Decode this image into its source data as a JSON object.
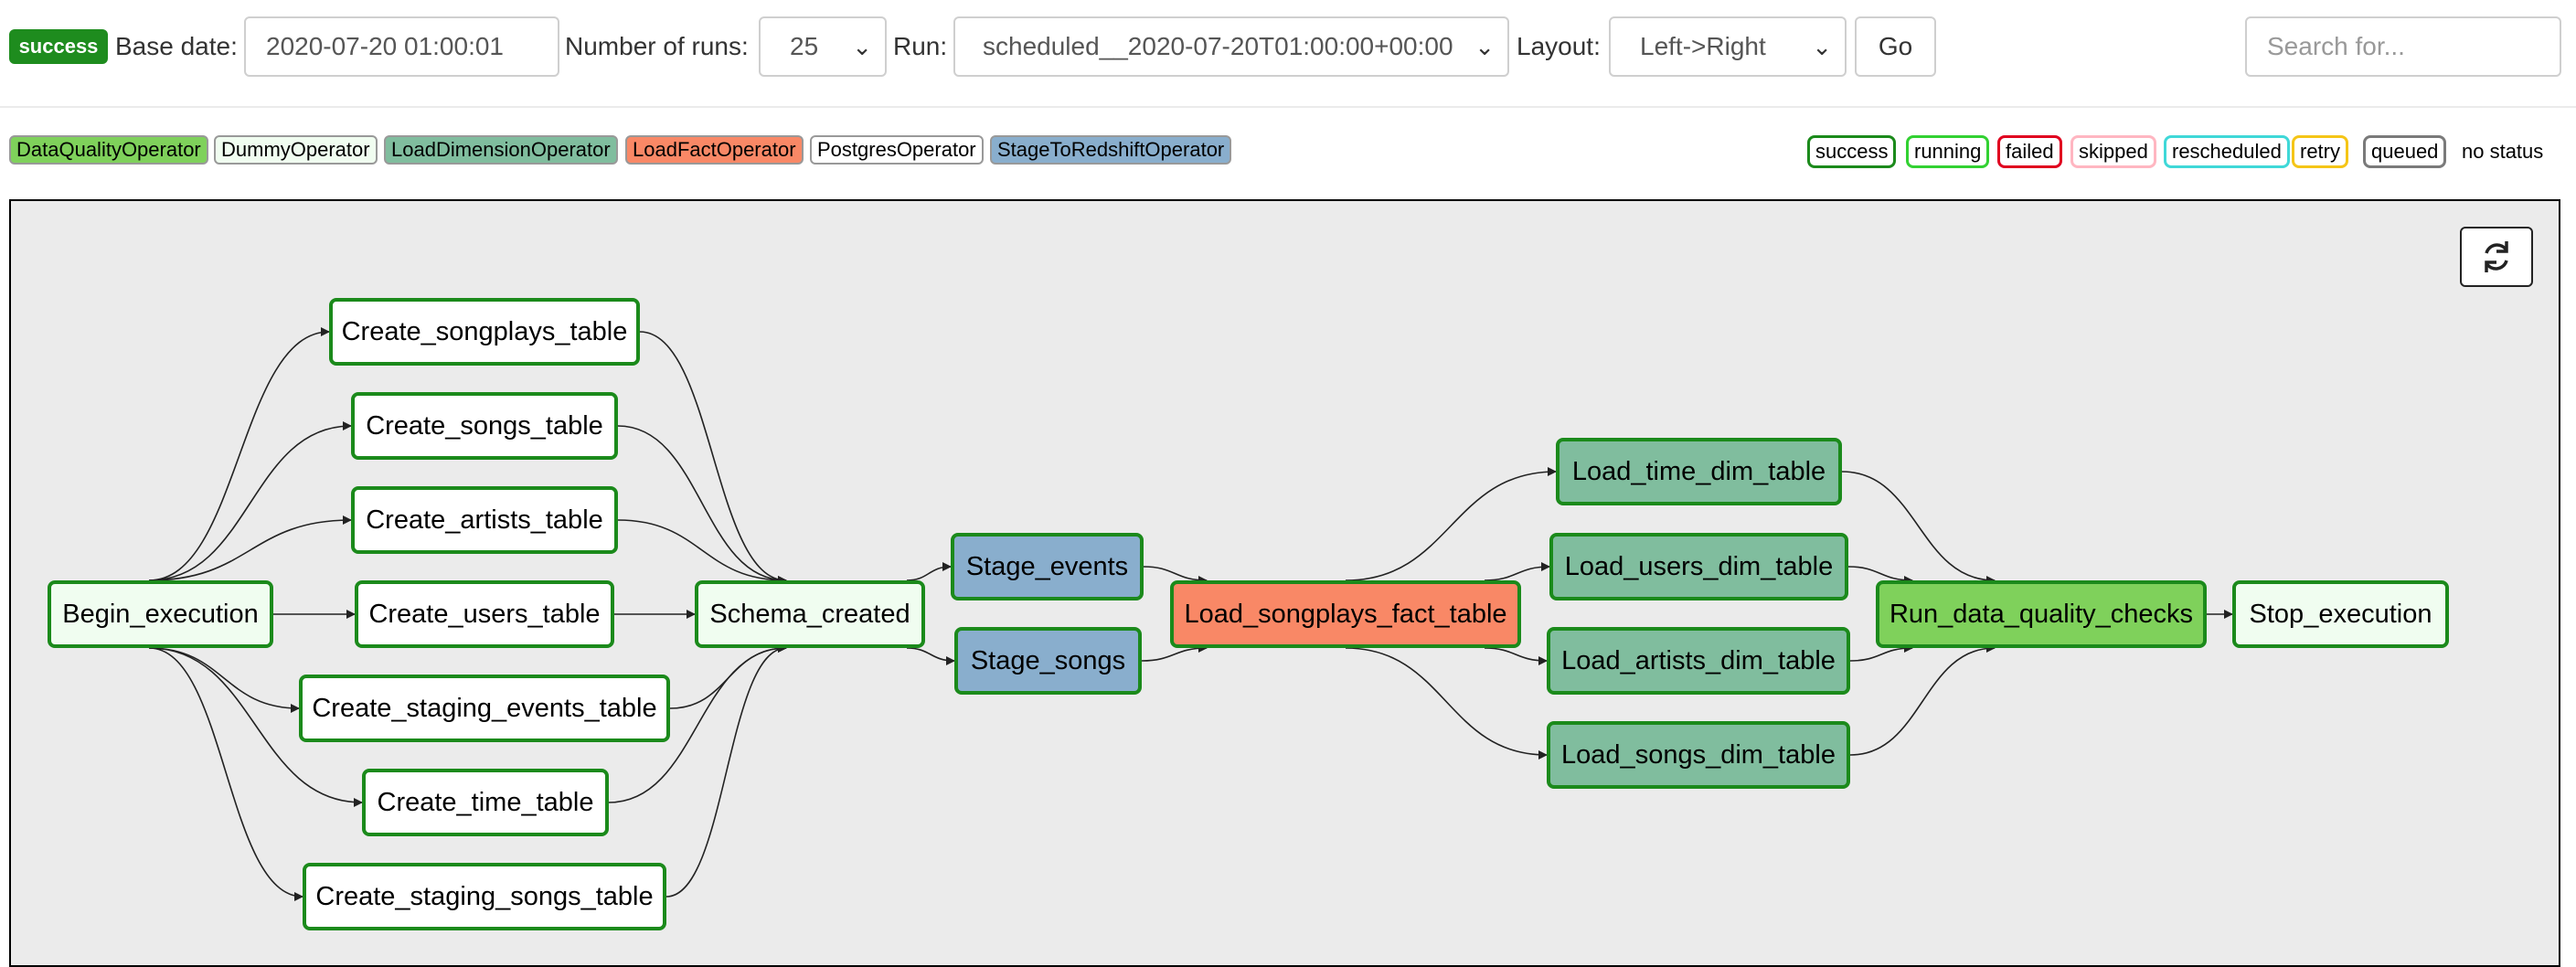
{
  "header": {
    "state_badge": "success",
    "base_date_label": "Base date:",
    "base_date_value": "2020-07-20 01:00:01",
    "num_runs_label": "Number of runs:",
    "num_runs_value": "25",
    "run_label": "Run:",
    "run_value": "scheduled__2020-07-20T01:00:00+00:00",
    "layout_label": "Layout:",
    "layout_value": "Left->Right",
    "go_label": "Go",
    "search_placeholder": "Search for..."
  },
  "operators": [
    {
      "label": "DataQualityOperator",
      "color": "#7fd15b"
    },
    {
      "label": "DummyOperator",
      "color": "#f0fdf0"
    },
    {
      "label": "LoadDimensionOperator",
      "color": "#80bd9e"
    },
    {
      "label": "LoadFactOperator",
      "color": "#f98866"
    },
    {
      "label": "PostgresOperator",
      "color": "#ffffff"
    },
    {
      "label": "StageToRedshiftOperator",
      "color": "#89aecd"
    }
  ],
  "states": [
    {
      "label": "success",
      "color": "#1b8a1b"
    },
    {
      "label": "running",
      "color": "#32d132"
    },
    {
      "label": "failed",
      "color": "#e0001f"
    },
    {
      "label": "skipped",
      "color": "#ffb6c1"
    },
    {
      "label": "rescheduled",
      "color": "#3fd8d8"
    },
    {
      "label": "retry",
      "color": "#f5c517"
    },
    {
      "label": "queued",
      "color": "#7a7a7a"
    },
    {
      "label": "no status",
      "color": ""
    }
  ],
  "refresh_icon": "refresh-icon",
  "tasks": [
    {
      "id": "begin",
      "label": "Begin_execution",
      "color": "#f0fdf0"
    },
    {
      "id": "c_songplays",
      "label": "Create_songplays_table",
      "color": "#ffffff"
    },
    {
      "id": "c_songs",
      "label": "Create_songs_table",
      "color": "#ffffff"
    },
    {
      "id": "c_artists",
      "label": "Create_artists_table",
      "color": "#ffffff"
    },
    {
      "id": "c_users",
      "label": "Create_users_table",
      "color": "#ffffff"
    },
    {
      "id": "c_staging_events",
      "label": "Create_staging_events_table",
      "color": "#ffffff"
    },
    {
      "id": "c_time",
      "label": "Create_time_table",
      "color": "#ffffff"
    },
    {
      "id": "c_staging_songs",
      "label": "Create_staging_songs_table",
      "color": "#ffffff"
    },
    {
      "id": "schema",
      "label": "Schema_created",
      "color": "#f0fdf0"
    },
    {
      "id": "stage_events",
      "label": "Stage_events",
      "color": "#89aecd"
    },
    {
      "id": "stage_songs",
      "label": "Stage_songs",
      "color": "#89aecd"
    },
    {
      "id": "load_fact",
      "label": "Load_songplays_fact_table",
      "color": "#f98866"
    },
    {
      "id": "load_time",
      "label": "Load_time_dim_table",
      "color": "#80bd9e"
    },
    {
      "id": "load_users",
      "label": "Load_users_dim_table",
      "color": "#80bd9e"
    },
    {
      "id": "load_artists",
      "label": "Load_artists_dim_table",
      "color": "#80bd9e"
    },
    {
      "id": "load_songs",
      "label": "Load_songs_dim_table",
      "color": "#80bd9e"
    },
    {
      "id": "dq",
      "label": "Run_data_quality_checks",
      "color": "#7fd15b"
    },
    {
      "id": "stop",
      "label": "Stop_execution",
      "color": "#f0fdf0"
    }
  ],
  "edges": [
    [
      "begin",
      "c_songplays"
    ],
    [
      "begin",
      "c_songs"
    ],
    [
      "begin",
      "c_artists"
    ],
    [
      "begin",
      "c_users"
    ],
    [
      "begin",
      "c_staging_events"
    ],
    [
      "begin",
      "c_time"
    ],
    [
      "begin",
      "c_staging_songs"
    ],
    [
      "c_songplays",
      "schema"
    ],
    [
      "c_songs",
      "schema"
    ],
    [
      "c_artists",
      "schema"
    ],
    [
      "c_users",
      "schema"
    ],
    [
      "c_staging_events",
      "schema"
    ],
    [
      "c_time",
      "schema"
    ],
    [
      "c_staging_songs",
      "schema"
    ],
    [
      "schema",
      "stage_events"
    ],
    [
      "schema",
      "stage_songs"
    ],
    [
      "stage_events",
      "load_fact"
    ],
    [
      "stage_songs",
      "load_fact"
    ],
    [
      "load_fact",
      "load_time"
    ],
    [
      "load_fact",
      "load_users"
    ],
    [
      "load_fact",
      "load_artists"
    ],
    [
      "load_fact",
      "load_songs"
    ],
    [
      "load_time",
      "dq"
    ],
    [
      "load_users",
      "dq"
    ],
    [
      "load_artists",
      "dq"
    ],
    [
      "load_songs",
      "dq"
    ],
    [
      "dq",
      "stop"
    ]
  ]
}
